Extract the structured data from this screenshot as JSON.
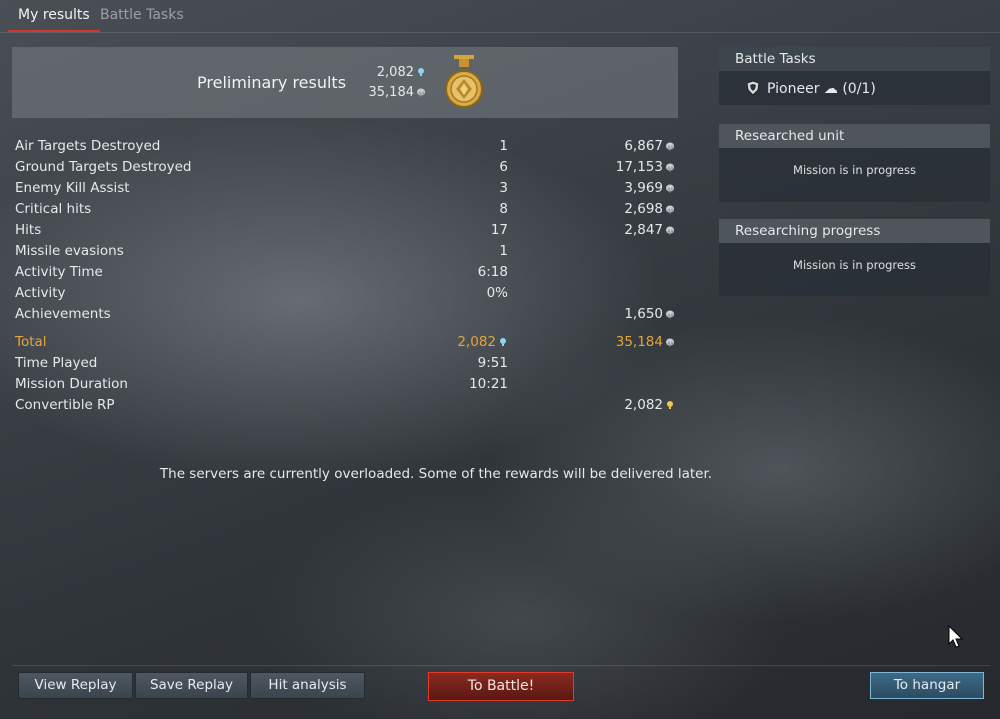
{
  "tabs": [
    {
      "label": "My results",
      "active": true
    },
    {
      "label": "Battle Tasks",
      "active": false
    }
  ],
  "preliminary": {
    "title": "Preliminary results",
    "rp": "2,082",
    "sl": "35,184"
  },
  "stats": [
    {
      "label": "Air Targets Destroyed",
      "count": "1",
      "reward": "6,867"
    },
    {
      "label": "Ground Targets Destroyed",
      "count": "6",
      "reward": "17,153"
    },
    {
      "label": "Enemy Kill Assist",
      "count": "3",
      "reward": "3,969"
    },
    {
      "label": "Critical hits",
      "count": "8",
      "reward": "2,698"
    },
    {
      "label": "Hits",
      "count": "17",
      "reward": "2,847"
    },
    {
      "label": "Missile evasions",
      "count": "1",
      "reward": ""
    },
    {
      "label": "Activity Time",
      "count": "6:18",
      "reward": ""
    },
    {
      "label": "Activity",
      "count": "0%",
      "reward": ""
    },
    {
      "label": "Achievements",
      "count": "",
      "reward": "1,650"
    }
  ],
  "total": {
    "label": "Total",
    "rp": "2,082",
    "sl": "35,184"
  },
  "extra": [
    {
      "label": "Time Played",
      "value": "9:51"
    },
    {
      "label": "Mission Duration",
      "value": "10:21"
    }
  ],
  "convertible": {
    "label": "Convertible RP",
    "value": "2,082"
  },
  "notice": "The servers are currently overloaded. Some of the rewards will be delivered later.",
  "side": {
    "battle_tasks": {
      "title": "Battle Tasks",
      "task": "Pioneer ☁ (0/1)"
    },
    "researched_unit": {
      "title": "Researched unit",
      "message": "Mission is in progress"
    },
    "researching_progress": {
      "title": "Researching progress",
      "message": "Mission is in progress"
    }
  },
  "buttons": {
    "view_replay": "View Replay",
    "save_replay": "Save Replay",
    "hit_analysis": "Hit analysis",
    "to_battle": "To Battle!",
    "to_hangar": "To hangar"
  },
  "colors": {
    "accent_total": "#e5a53a",
    "tab_underline": "#d5362b",
    "battle_border": "#e23a2a",
    "hangar_border": "#7fb6d8"
  }
}
